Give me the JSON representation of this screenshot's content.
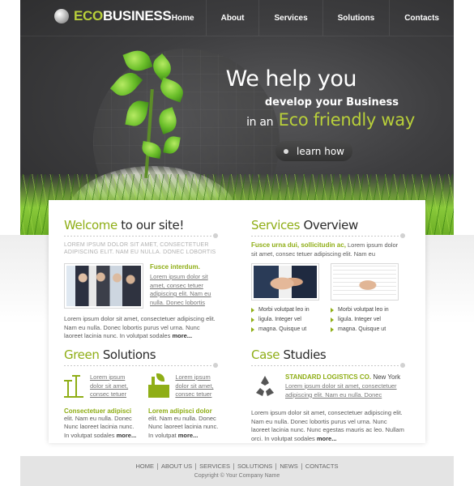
{
  "brand": {
    "eco": "ECO",
    "business": "BUSINESS"
  },
  "nav": [
    "Home",
    "About",
    "Services",
    "Solutions",
    "Contacts"
  ],
  "hero": {
    "line1": "We help you",
    "line2": "develop your Business",
    "line3_pre": "in an",
    "line3_eco": "Eco friendly way",
    "button": "learn how"
  },
  "welcome": {
    "title_g": "Welcome",
    "title_rest": "to our site!",
    "caps": "LOREM IPSUM DOLOR SIT AMET, CONSECTETUER ADIPISCING ELIT. NAM EU NULLA. DONEC LOBORTIS",
    "photo_title": "Fusce interdum.",
    "photo_text": "Lorem ipsum dolor sit amet, consec tetuer adipiscing elit. Nam eu nulla. Donec lobortis",
    "body": "Lorem ipsum dolor sit amet, consectetuer adipiscing elit. Nam eu nulla. Donec lobortis purus vel urna. Nunc laoreet lacinia nunc. In volutpat sodales",
    "more": "more..."
  },
  "services": {
    "title_g": "Services",
    "title_rest": "Overview",
    "lead_g": "Fusce urna dui, sollicitudin ac,",
    "lead_rest": "Lorem ipsum dolor sit amet, consec tetuer adipiscing elit. Nam eu",
    "bullets_left": [
      "Morbi volutpat leo in",
      "ligula. Integer vel",
      "magna. Quisque ut"
    ],
    "bullets_right": [
      "Morbi volutpat leo in",
      "ligula. Integer vel",
      "magna. Quisque ut"
    ]
  },
  "green": {
    "title_g": "Green",
    "title_rest": "Solutions",
    "item1_text": "Lorem ipsum dolor sit amet, consec tetuer",
    "item2_text": "Lorem ipsum dolor sit amet, consec tetuer",
    "item1_title": "Consectetuer adipisci",
    "item1_body": "elit. Nam eu nulla. Donec Nunc laoreet lacinia nunc. In volutpat sodales",
    "item2_title": "Lorem adipisci dolor",
    "item2_body": "elit. Nam eu nulla. Donec Nunc laoreet lacinia nunc. In volutpat",
    "more": "more..."
  },
  "cases": {
    "title_g": "Case",
    "title_rest": "Studies",
    "company_g": "STANDARD LOGISTICS CO.",
    "company_city": "New York",
    "company_text": "Lorem ipsum dolor sit amet, consectetuer adipiscing elit. Nam eu nulla. Donec",
    "body": "Lorem ipsum dolor sit amet, consectetuer adipiscing elit. Nam eu nulla. Donec lobortis purus vel urna. Nunc laoreet lacinia nunc. Nunc egestas mauris ac leo. Nullam orci. In volutpat sodales",
    "more": "more..."
  },
  "footer": {
    "links": [
      "HOME",
      "ABOUT US",
      "SERVICES",
      "SOLUTIONS",
      "NEWS",
      "CONTACTS"
    ],
    "copyright": "Copyright © Your Company Name"
  },
  "colors": {
    "accent": "#8fae16",
    "logo_eco": "#b8cf3a",
    "header_bg": "#3e3e40"
  }
}
